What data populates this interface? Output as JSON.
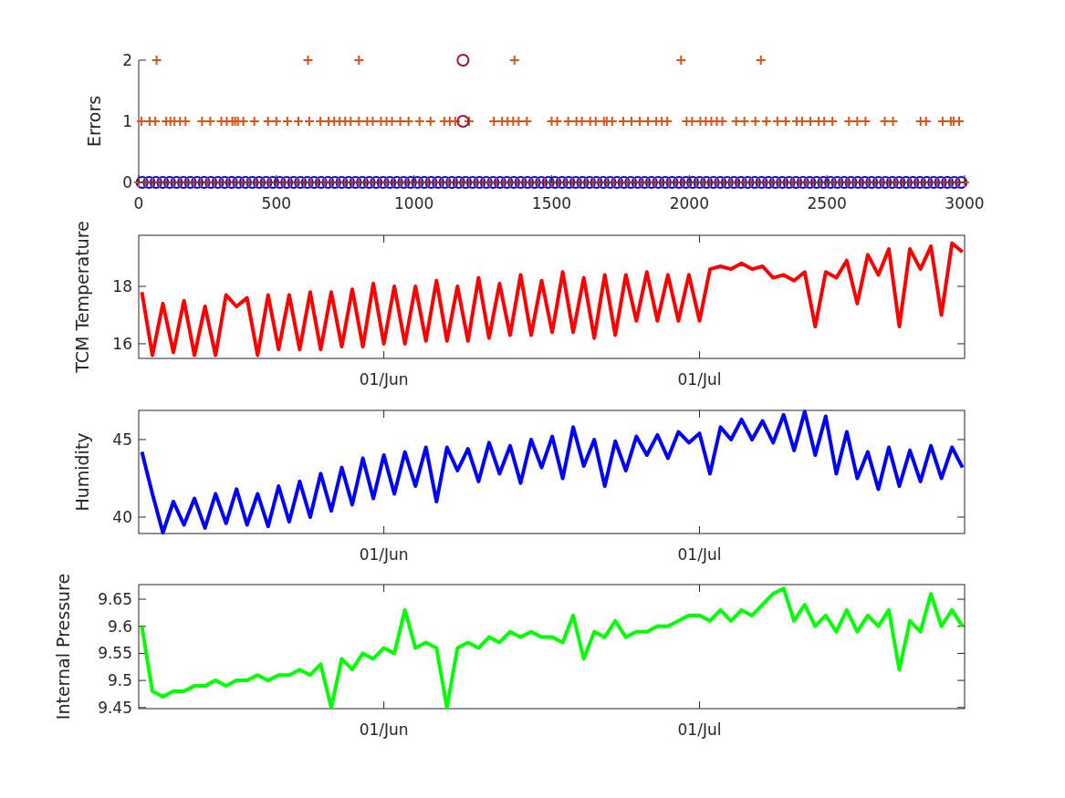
{
  "figure": {
    "panels": [
      {
        "chart_data": {
          "type": "scatter",
          "ylabel": "Errors",
          "xlim": [
            0,
            3000
          ],
          "ylim": [
            0,
            2
          ],
          "xticks": [
            0,
            500,
            1000,
            1500,
            2000,
            2500,
            3000
          ],
          "yticks": [
            0,
            1,
            2
          ],
          "series": [
            {
              "color": "#0000ff",
              "marker": "circle",
              "x": [
                12.5,
                37.5,
                62.5,
                87.5,
                112.5,
                137.5,
                162.5,
                187.5,
                212.5,
                237.5,
                262.5,
                287.5,
                312.5,
                337.5,
                362.5,
                387.5,
                412.5,
                437.5,
                462.5,
                487.5,
                512.5,
                537.5,
                562.5,
                587.5,
                612.5,
                637.5,
                662.5,
                687.5,
                712.5,
                737.5,
                762.5,
                787.5,
                812.5,
                837.5,
                862.5,
                887.5,
                912.5,
                937.5,
                962.5,
                987.5,
                1012.5,
                1037.5,
                1062.5,
                1087.5,
                1112.5,
                1137.5,
                1162.5,
                1187.5,
                1212.5,
                1237.5,
                1262.5,
                1287.5,
                1312.5,
                1337.5,
                1362.5,
                1387.5,
                1412.5,
                1437.5,
                1462.5,
                1487.5,
                1512.5,
                1537.5,
                1562.5,
                1587.5,
                1612.5,
                1637.5,
                1662.5,
                1687.5,
                1712.5,
                1737.5,
                1762.5,
                1787.5,
                1812.5,
                1837.5,
                1862.5,
                1887.5,
                1912.5,
                1937.5,
                1962.5,
                1987.5,
                2012.5,
                2037.5,
                2062.5,
                2087.5,
                2112.5,
                2137.5,
                2162.5,
                2187.5,
                2212.5,
                2237.5,
                2262.5,
                2287.5,
                2312.5,
                2337.5,
                2362.5,
                2387.5,
                2412.5,
                2437.5,
                2462.5,
                2487.5,
                2512.5,
                2537.5,
                2562.5,
                2587.5,
                2612.5,
                2637.5,
                2662.5,
                2687.5,
                2712.5,
                2737.5,
                2762.5,
                2787.5,
                2812.5,
                2837.5,
                2862.5,
                2887.5,
                2912.5,
                2937.5,
                2962.5,
                2987.5
              ],
              "values": [
                0,
                0,
                0,
                0,
                0,
                0,
                0,
                0,
                0,
                0,
                0,
                0,
                0,
                0,
                0,
                0,
                0,
                0,
                0,
                0,
                0,
                0,
                0,
                0,
                0,
                0,
                0,
                0,
                0,
                0,
                0,
                0,
                0,
                0,
                0,
                0,
                0,
                0,
                0,
                0,
                0,
                0,
                0,
                0,
                0,
                0,
                0,
                0,
                0,
                0,
                0,
                0,
                0,
                0,
                0,
                0,
                0,
                0,
                0,
                0,
                0,
                0,
                0,
                0,
                0,
                0,
                0,
                0,
                0,
                0,
                0,
                0,
                0,
                0,
                0,
                0,
                0,
                0,
                0,
                0,
                0,
                0,
                0,
                0,
                0,
                0,
                0,
                0,
                0,
                0,
                0,
                0,
                0,
                0,
                0,
                0,
                0,
                0,
                0,
                0,
                0,
                0,
                0,
                0,
                0,
                0,
                0,
                0,
                0,
                0,
                0,
                0,
                0,
                0,
                0,
                0,
                0,
                0,
                0,
                0
              ]
            },
            {
              "color": "#d95319",
              "marker": "plus",
              "x": [
                0,
                25,
                50,
                75,
                100,
                125,
                150,
                175,
                200,
                225,
                250,
                275,
                300,
                325,
                350,
                375,
                400,
                425,
                450,
                475,
                500,
                525,
                550,
                575,
                600,
                625,
                650,
                675,
                700,
                725,
                750,
                775,
                800,
                825,
                850,
                875,
                900,
                925,
                950,
                975,
                1000,
                1025,
                1050,
                1075,
                1100,
                1125,
                1150,
                1175,
                1200,
                1225,
                1250,
                1275,
                1300,
                1325,
                1350,
                1375,
                1400,
                1425,
                1450,
                1475,
                1500,
                1525,
                1550,
                1575,
                1600,
                1625,
                1650,
                1675,
                1700,
                1725,
                1750,
                1775,
                1800,
                1825,
                1850,
                1875,
                1900,
                1925,
                1950,
                1975,
                2000,
                2025,
                2050,
                2075,
                2100,
                2125,
                2150,
                2175,
                2200,
                2225,
                2250,
                2275,
                2300,
                2325,
                2350,
                2375,
                2400,
                2425,
                2450,
                2475,
                2500,
                2525,
                2550,
                2575,
                2600,
                2625,
                2650,
                2675,
                2700,
                2725,
                2750,
                2775,
                2800,
                2825,
                2850,
                2875,
                2900,
                2925,
                2950,
                2975,
                3000
              ],
              "values": [
                0,
                0,
                0,
                0,
                0,
                0,
                0,
                0,
                0,
                0,
                0,
                0,
                0,
                0,
                0,
                0,
                0,
                0,
                0,
                0,
                0,
                0,
                0,
                0,
                0,
                0,
                0,
                0,
                0,
                0,
                0,
                0,
                0,
                0,
                0,
                0,
                0,
                0,
                0,
                0,
                0,
                0,
                0,
                0,
                0,
                0,
                0,
                0,
                0,
                0,
                0,
                0,
                0,
                0,
                0,
                0,
                0,
                0,
                0,
                0,
                0,
                0,
                0,
                0,
                0,
                0,
                0,
                0,
                0,
                0,
                0,
                0,
                0,
                0,
                0,
                0,
                0,
                0,
                0,
                0,
                0,
                0,
                0,
                0,
                0,
                0,
                0,
                0,
                0,
                0,
                0,
                0,
                0,
                0,
                0,
                0,
                0,
                0,
                0,
                0,
                0,
                0,
                0,
                0,
                0,
                0,
                0,
                0,
                0,
                0,
                0,
                0,
                0,
                0,
                0,
                0,
                0,
                0,
                0,
                0,
                0
              ]
            },
            {
              "color": "#d95319",
              "marker": "plus",
              "x": [
                10,
                40,
                60,
                100,
                115,
                130,
                150,
                170,
                230,
                260,
                300,
                320,
                340,
                350,
                360,
                380,
                420,
                470,
                500,
                540,
                580,
                620,
                660,
                690,
                710,
                730,
                750,
                770,
                800,
                830,
                850,
                880,
                900,
                920,
                950,
                980,
                1020,
                1060,
                1110,
                1130,
                1150,
                1200,
                1290,
                1320,
                1340,
                1360,
                1380,
                1410,
                1500,
                1520,
                1560,
                1590,
                1610,
                1640,
                1660,
                1690,
                1700,
                1720,
                1760,
                1790,
                1820,
                1850,
                1880,
                1900,
                1920,
                1990,
                2010,
                2040,
                2060,
                2080,
                2100,
                2120,
                2170,
                2200,
                2240,
                2280,
                2320,
                2350,
                2390,
                2410,
                2440,
                2470,
                2490,
                2520,
                2580,
                2610,
                2640,
                2710,
                2740,
                2840,
                2860,
                2920,
                2950,
                2960,
                2980,
                65,
                615,
                800,
                1365,
                1970,
                2260
              ],
              "values": [
                1,
                1,
                1,
                1,
                1,
                1,
                1,
                1,
                1,
                1,
                1,
                1,
                1,
                1,
                1,
                1,
                1,
                1,
                1,
                1,
                1,
                1,
                1,
                1,
                1,
                1,
                1,
                1,
                1,
                1,
                1,
                1,
                1,
                1,
                1,
                1,
                1,
                1,
                1,
                1,
                1,
                1,
                1,
                1,
                1,
                1,
                1,
                1,
                1,
                1,
                1,
                1,
                1,
                1,
                1,
                1,
                1,
                1,
                1,
                1,
                1,
                1,
                1,
                1,
                1,
                1,
                1,
                1,
                1,
                1,
                1,
                1,
                1,
                1,
                1,
                1,
                1,
                1,
                1,
                1,
                1,
                1,
                1,
                1,
                1,
                1,
                1,
                1,
                1,
                1,
                1,
                1,
                1,
                1,
                1,
                2,
                2,
                2,
                2,
                2,
                2
              ]
            },
            {
              "color": "#a2142f",
              "marker": "circle",
              "x": [
                1178,
                1178
              ],
              "values": [
                1,
                2
              ]
            }
          ]
        }
      },
      {
        "chart_data": {
          "type": "line",
          "ylabel": "TCM Temperature",
          "ylim": [
            15.49,
            19.78
          ],
          "yticks": [
            16,
            18
          ],
          "categories": [
            null,
            null,
            null,
            null,
            null,
            null,
            null,
            null,
            null,
            null,
            null,
            null,
            null,
            null,
            null,
            null,
            null,
            null,
            null,
            null,
            null,
            null,
            null,
            "01/Jun",
            null,
            null,
            null,
            null,
            null,
            null,
            null,
            null,
            null,
            null,
            null,
            null,
            null,
            null,
            null,
            null,
            null,
            null,
            null,
            null,
            null,
            null,
            null,
            null,
            null,
            null,
            null,
            null,
            null,
            "01/Jul",
            null,
            null,
            null,
            null,
            null,
            null,
            null,
            null,
            null,
            null,
            null,
            null,
            null,
            null,
            null,
            null,
            null,
            null,
            null,
            null,
            null,
            null,
            null,
            null,
            null
          ],
          "series": [
            {
              "color": "#ff0000",
              "values": [
                17.8,
                15.6,
                17.4,
                15.7,
                17.5,
                15.6,
                17.3,
                15.6,
                17.7,
                17.3,
                17.6,
                15.6,
                17.7,
                15.8,
                17.7,
                15.8,
                17.8,
                15.8,
                17.8,
                15.9,
                17.9,
                15.9,
                18.1,
                16.0,
                18.0,
                16.0,
                18.0,
                16.1,
                18.2,
                16.1,
                18.0,
                16.1,
                18.3,
                16.2,
                18.1,
                16.3,
                18.4,
                16.3,
                18.2,
                16.4,
                18.5,
                16.4,
                18.3,
                16.2,
                18.4,
                16.3,
                18.4,
                16.8,
                18.5,
                16.8,
                18.4,
                16.8,
                18.4,
                16.8,
                18.6,
                18.7,
                18.6,
                18.8,
                18.6,
                18.7,
                18.3,
                18.4,
                18.2,
                18.5,
                16.6,
                18.5,
                18.3,
                18.9,
                17.4,
                19.1,
                18.4,
                19.3,
                16.6,
                19.3,
                18.6,
                19.4,
                17.0,
                19.5,
                19.2
              ]
            }
          ]
        }
      },
      {
        "chart_data": {
          "type": "line",
          "ylabel": "Humidity",
          "ylim": [
            38.94,
            46.88
          ],
          "yticks": [
            40,
            45
          ],
          "categories": [
            null,
            null,
            null,
            null,
            null,
            null,
            null,
            null,
            null,
            null,
            null,
            null,
            null,
            null,
            null,
            null,
            null,
            null,
            null,
            null,
            null,
            null,
            null,
            "01/Jun",
            null,
            null,
            null,
            null,
            null,
            null,
            null,
            null,
            null,
            null,
            null,
            null,
            null,
            null,
            null,
            null,
            null,
            null,
            null,
            null,
            null,
            null,
            null,
            null,
            null,
            null,
            null,
            null,
            null,
            "01/Jul",
            null,
            null,
            null,
            null,
            null,
            null,
            null,
            null,
            null,
            null,
            null,
            null,
            null,
            null,
            null,
            null,
            null,
            null,
            null,
            null,
            null,
            null,
            null,
            null,
            null
          ],
          "series": [
            {
              "color": "#0000ff",
              "values": [
                44.2,
                41.5,
                39.0,
                41.0,
                39.5,
                41.2,
                39.3,
                41.5,
                39.6,
                41.8,
                39.5,
                41.5,
                39.4,
                42.0,
                39.7,
                42.3,
                40.0,
                42.8,
                40.4,
                43.2,
                40.8,
                43.8,
                41.2,
                44.0,
                41.5,
                44.2,
                42.0,
                44.5,
                41.0,
                44.5,
                43.0,
                44.4,
                42.3,
                44.8,
                42.8,
                44.6,
                42.2,
                45.0,
                43.2,
                45.2,
                42.5,
                45.8,
                43.3,
                45.0,
                42.0,
                44.9,
                43.0,
                45.2,
                44.0,
                45.3,
                43.8,
                45.5,
                44.8,
                45.4,
                42.8,
                45.8,
                45.0,
                46.3,
                45.0,
                46.2,
                44.8,
                46.6,
                44.3,
                46.8,
                44.0,
                46.5,
                42.8,
                45.5,
                42.5,
                44.2,
                41.8,
                44.5,
                42.0,
                44.3,
                42.3,
                44.6,
                42.5,
                44.5,
                43.2
              ]
            }
          ]
        }
      },
      {
        "chart_data": {
          "type": "line",
          "ylabel": "Internal Pressure",
          "ylim": [
            9.448,
            9.677
          ],
          "yticks": [
            9.45,
            9.5,
            9.55,
            9.6,
            9.65
          ],
          "categories": [
            null,
            null,
            null,
            null,
            null,
            null,
            null,
            null,
            null,
            null,
            null,
            null,
            null,
            null,
            null,
            null,
            null,
            null,
            null,
            null,
            null,
            null,
            null,
            "01/Jun",
            null,
            null,
            null,
            null,
            null,
            null,
            null,
            null,
            null,
            null,
            null,
            null,
            null,
            null,
            null,
            null,
            null,
            null,
            null,
            null,
            null,
            null,
            null,
            null,
            null,
            null,
            null,
            null,
            null,
            "01/Jul",
            null,
            null,
            null,
            null,
            null,
            null,
            null,
            null,
            null,
            null,
            null,
            null,
            null,
            null,
            null,
            null,
            null,
            null,
            null,
            null,
            null,
            null,
            null,
            null,
            null
          ],
          "series": [
            {
              "color": "#00ff00",
              "values": [
                9.6,
                9.48,
                9.47,
                9.48,
                9.48,
                9.49,
                9.49,
                9.5,
                9.49,
                9.5,
                9.5,
                9.51,
                9.5,
                9.51,
                9.51,
                9.52,
                9.51,
                9.53,
                9.45,
                9.54,
                9.52,
                9.55,
                9.54,
                9.56,
                9.55,
                9.63,
                9.56,
                9.57,
                9.56,
                9.45,
                9.56,
                9.57,
                9.56,
                9.58,
                9.57,
                9.59,
                9.58,
                9.59,
                9.58,
                9.58,
                9.57,
                9.62,
                9.54,
                9.59,
                9.58,
                9.61,
                9.58,
                9.59,
                9.59,
                9.6,
                9.6,
                9.61,
                9.62,
                9.62,
                9.61,
                9.63,
                9.61,
                9.63,
                9.62,
                9.64,
                9.66,
                9.67,
                9.61,
                9.64,
                9.6,
                9.62,
                9.59,
                9.63,
                9.59,
                9.62,
                9.6,
                9.63,
                9.52,
                9.61,
                9.59,
                9.66,
                9.6,
                9.63,
                9.6
              ]
            }
          ]
        }
      }
    ]
  }
}
